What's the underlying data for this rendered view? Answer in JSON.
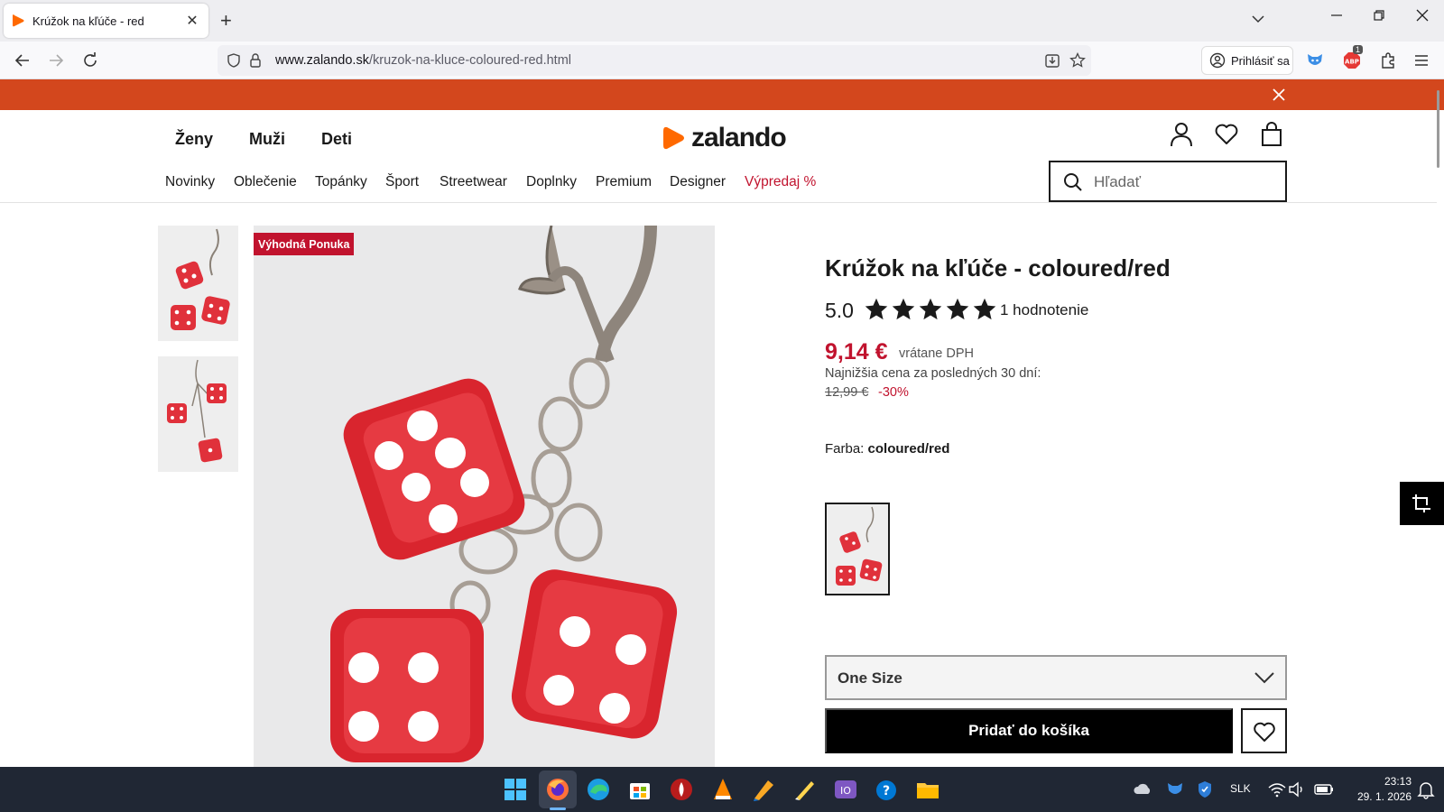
{
  "browser": {
    "tab_title": "Krúžok na kľúče - red",
    "url_domain": "www.zalando.sk",
    "url_path": "/kruzok-na-kluce-coloured-red.html",
    "signin_label": "Prihlásiť sa",
    "ext_badge": "1"
  },
  "site": {
    "logo": "zalando",
    "genders": [
      "Ženy",
      "Muži",
      "Deti"
    ],
    "categories": [
      "Novinky",
      "Oblečenie",
      "Topánky",
      "Šport",
      "Streetwear",
      "Doplnky",
      "Premium",
      "Designer",
      "Výpredaj %"
    ],
    "search_placeholder": "Hľadať",
    "accent_color": "#d3471d",
    "sale_color": "#c1132e"
  },
  "product": {
    "badge": "Výhodná Ponuka",
    "title": "Krúžok na kľúče - coloured/red",
    "rating_value": "5.0",
    "rating_stars": 5,
    "rating_count": "1 hodnotenie",
    "price": "9,14 €",
    "vat_note": "vrátane DPH",
    "lowest_price_label": "Najnižšia cena za posledných 30 dní:",
    "old_price": "12,99 €",
    "discount": "-30%",
    "color_label": "Farba:",
    "color_value": "coloured/red",
    "size": "One Size",
    "add_to_cart": "Pridať do košíka"
  },
  "taskbar": {
    "lang": "SLK",
    "time": "23:13",
    "date": "29. 1. 2026"
  }
}
